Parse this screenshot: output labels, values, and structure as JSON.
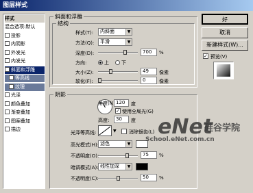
{
  "window": {
    "title": "图层样式"
  },
  "left": {
    "header": "样式",
    "items": [
      {
        "label": "混合选项:默认",
        "checkbox": false,
        "state": "normal"
      },
      {
        "label": "投影",
        "checkbox": true,
        "state": "normal"
      },
      {
        "label": "内阴影",
        "checkbox": true,
        "state": "normal"
      },
      {
        "label": "外发光",
        "checkbox": true,
        "state": "normal"
      },
      {
        "label": "内发光",
        "checkbox": true,
        "state": "normal"
      },
      {
        "label": "斜面和浮雕",
        "checkbox": true,
        "state": "selected"
      },
      {
        "label": "等高线",
        "checkbox": true,
        "state": "sub"
      },
      {
        "label": "纹理",
        "checkbox": true,
        "state": "sub"
      },
      {
        "label": "光泽",
        "checkbox": true,
        "state": "normal"
      },
      {
        "label": "颜色叠加",
        "checkbox": true,
        "state": "normal"
      },
      {
        "label": "渐变叠加",
        "checkbox": true,
        "state": "normal"
      },
      {
        "label": "图案叠加",
        "checkbox": true,
        "state": "normal"
      },
      {
        "label": "描边",
        "checkbox": true,
        "state": "normal"
      }
    ]
  },
  "bevel": {
    "group_title": "斜面和浮雕",
    "structure_title": "结构",
    "style_label": "样式(T):",
    "style_value": "内斜面",
    "method_label": "方法(Q):",
    "method_value": "平滑",
    "depth_label": "深度(D):",
    "depth_value": "700",
    "depth_unit": "%",
    "depth_level": 0.7,
    "direction_label": "方向:",
    "dir_up": "上",
    "dir_down": "下",
    "size_label": "大小(Z):",
    "size_value": "49",
    "size_unit": "像素",
    "size_level": 0.3,
    "soften_label": "软化(F):",
    "soften_value": "0",
    "soften_unit": "像素",
    "soften_level": 0
  },
  "shading": {
    "title": "阴影",
    "angle_label": "角度(N):",
    "angle_value": "120",
    "angle_unit": "度",
    "global_light": "使用全局光(G)",
    "altitude_label": "高度:",
    "altitude_value": "30",
    "altitude_unit": "度",
    "gloss_label": "光泽等高线:",
    "antialias": "消除锯齿(L)",
    "highlight_label": "高光模式(H):",
    "highlight_value": "滤色",
    "highlight_color": "#ffffff",
    "hl_opacity_label": "不透明度(O):",
    "hl_opacity_value": "75",
    "hl_opacity_unit": "%",
    "hl_opacity_level": 0.75,
    "shadow_label": "暗调模式(A):",
    "shadow_value": "线性加深",
    "shadow_color": "#000000",
    "sh_opacity_label": "不透明度(C):",
    "sh_opacity_value": "50",
    "sh_opacity_unit": "%",
    "sh_opacity_level": 0.5
  },
  "buttons": {
    "ok": "好",
    "cancel": "取消",
    "new_style": "新建样式(W)...",
    "preview": "预览(V)"
  },
  "watermark": {
    "text1": "eNet",
    "text2": "硅谷学院",
    "text3": "School.eNet.com.cn"
  }
}
